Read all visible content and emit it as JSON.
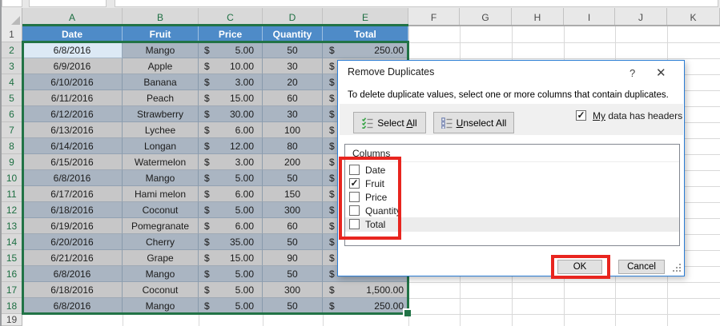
{
  "spreadsheet": {
    "currency_symbol": "$",
    "columns": [
      {
        "label": "A",
        "selected": true
      },
      {
        "label": "B",
        "selected": true
      },
      {
        "label": "C",
        "selected": true
      },
      {
        "label": "D",
        "selected": true
      },
      {
        "label": "E",
        "selected": true
      },
      {
        "label": "F",
        "selected": false
      },
      {
        "label": "G",
        "selected": false
      },
      {
        "label": "H",
        "selected": false
      },
      {
        "label": "I",
        "selected": false
      },
      {
        "label": "J",
        "selected": false
      },
      {
        "label": "K",
        "selected": false
      }
    ],
    "row_numbers": [
      {
        "label": "1",
        "selected": false
      },
      {
        "label": "2",
        "selected": true
      },
      {
        "label": "3",
        "selected": true
      },
      {
        "label": "4",
        "selected": true
      },
      {
        "label": "5",
        "selected": true
      },
      {
        "label": "6",
        "selected": true
      },
      {
        "label": "7",
        "selected": true
      },
      {
        "label": "8",
        "selected": true
      },
      {
        "label": "9",
        "selected": true
      },
      {
        "label": "10",
        "selected": true
      },
      {
        "label": "11",
        "selected": true
      },
      {
        "label": "12",
        "selected": true
      },
      {
        "label": "13",
        "selected": true
      },
      {
        "label": "14",
        "selected": true
      },
      {
        "label": "15",
        "selected": true
      },
      {
        "label": "16",
        "selected": true
      },
      {
        "label": "17",
        "selected": true
      },
      {
        "label": "18",
        "selected": true
      },
      {
        "label": "19",
        "selected": false
      }
    ],
    "table_header": [
      "Date",
      "Fruit",
      "Price",
      "Quantity",
      "Total"
    ],
    "rows": [
      {
        "n": "2",
        "date": "6/8/2016",
        "fruit": "Mango",
        "price": "5.00",
        "quantity": "50",
        "total": "250.00",
        "active": true
      },
      {
        "n": "3",
        "date": "6/9/2016",
        "fruit": "Apple",
        "price": "10.00",
        "quantity": "30",
        "total": ""
      },
      {
        "n": "4",
        "date": "6/10/2016",
        "fruit": "Banana",
        "price": "3.00",
        "quantity": "20",
        "total": ""
      },
      {
        "n": "5",
        "date": "6/11/2016",
        "fruit": "Peach",
        "price": "15.00",
        "quantity": "60",
        "total": ""
      },
      {
        "n": "6",
        "date": "6/12/2016",
        "fruit": "Strawberry",
        "price": "30.00",
        "quantity": "30",
        "total": ""
      },
      {
        "n": "7",
        "date": "6/13/2016",
        "fruit": "Lychee",
        "price": "6.00",
        "quantity": "100",
        "total": ""
      },
      {
        "n": "8",
        "date": "6/14/2016",
        "fruit": "Longan",
        "price": "12.00",
        "quantity": "80",
        "total": ""
      },
      {
        "n": "9",
        "date": "6/15/2016",
        "fruit": "Watermelon",
        "price": "3.00",
        "quantity": "200",
        "total": ""
      },
      {
        "n": "10",
        "date": "6/8/2016",
        "fruit": "Mango",
        "price": "5.00",
        "quantity": "50",
        "total": ""
      },
      {
        "n": "11",
        "date": "6/17/2016",
        "fruit": "Hami melon",
        "price": "6.00",
        "quantity": "150",
        "total": ""
      },
      {
        "n": "12",
        "date": "6/18/2016",
        "fruit": "Coconut",
        "price": "5.00",
        "quantity": "300",
        "total": ""
      },
      {
        "n": "13",
        "date": "6/19/2016",
        "fruit": "Pomegranate",
        "price": "6.00",
        "quantity": "60",
        "total": ""
      },
      {
        "n": "14",
        "date": "6/20/2016",
        "fruit": "Cherry",
        "price": "35.00",
        "quantity": "50",
        "total": ""
      },
      {
        "n": "15",
        "date": "6/21/2016",
        "fruit": "Grape",
        "price": "15.00",
        "quantity": "90",
        "total": ""
      },
      {
        "n": "16",
        "date": "6/8/2016",
        "fruit": "Mango",
        "price": "5.00",
        "quantity": "50",
        "total": ""
      },
      {
        "n": "17",
        "date": "6/18/2016",
        "fruit": "Coconut",
        "price": "5.00",
        "quantity": "300",
        "total": "1,500.00"
      },
      {
        "n": "18",
        "date": "6/8/2016",
        "fruit": "Mango",
        "price": "5.00",
        "quantity": "50",
        "total": "250.00"
      }
    ]
  },
  "dialog": {
    "title": "Remove Duplicates",
    "help_icon": "?",
    "close_icon": "✕",
    "description": "To delete duplicate values, select one or more columns that contain duplicates.",
    "select_all": {
      "pre": "Select ",
      "accel": "A",
      "post": "ll"
    },
    "unselect_all": {
      "pre": "",
      "accel": "U",
      "post": "nselect All"
    },
    "my_data_has_headers": {
      "pre": "",
      "accel": "My",
      "post": " data has headers",
      "checked": true,
      "check_glyph": "✓"
    },
    "columns_header": "Columns",
    "column_items": [
      {
        "label": "Date",
        "checked": false,
        "highlighted": false
      },
      {
        "label": "Fruit",
        "checked": true,
        "highlighted": false
      },
      {
        "label": "Price",
        "checked": false,
        "highlighted": false
      },
      {
        "label": "Quantity",
        "checked": false,
        "highlighted": false
      },
      {
        "label": "Total",
        "checked": false,
        "highlighted": true
      }
    ],
    "check_glyph": "✓",
    "ok": "OK",
    "cancel": "Cancel"
  },
  "colors": {
    "excel_green": "#217346",
    "table_header_blue": "#4e8bc8",
    "band_row_blue_gray": "#aab5c2",
    "band_row_gray": "#c7c7c8",
    "active_cell": "#dce9f5",
    "annotation_red": "#e8251f",
    "dialog_border_blue": "#2a7cd4"
  }
}
